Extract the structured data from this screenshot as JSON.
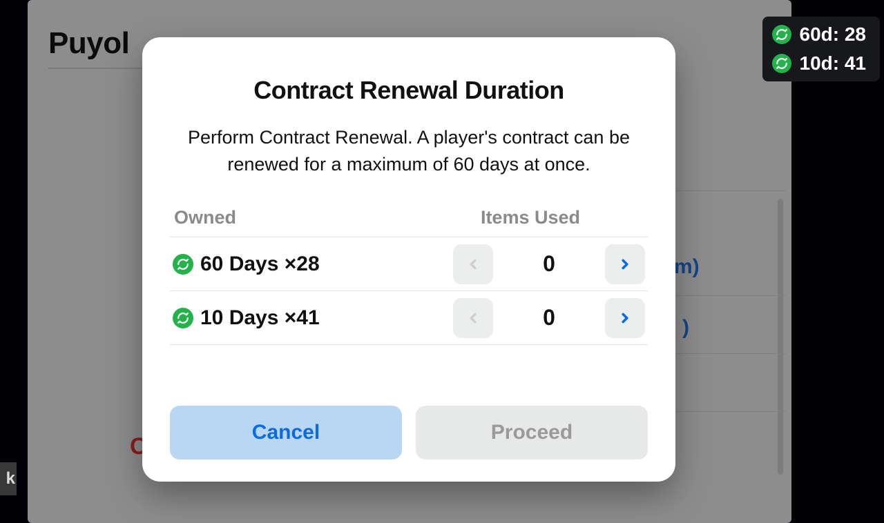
{
  "background": {
    "player_name": "Puyol",
    "peek_c": "C",
    "peek_m": "m)",
    "peek_paren": ")",
    "peek_k": "k"
  },
  "counter": {
    "items": [
      {
        "label": "60d: 28"
      },
      {
        "label": "10d: 41"
      }
    ]
  },
  "modal": {
    "title": "Contract Renewal Duration",
    "description": "Perform Contract Renewal. A player's contract can be renewed for a maximum of 60 days at once.",
    "table": {
      "owned_header": "Owned",
      "used_header": "Items Used",
      "rows": [
        {
          "label": "60 Days ×28",
          "value": "0"
        },
        {
          "label": "10 Days ×41",
          "value": "0"
        }
      ]
    },
    "buttons": {
      "cancel": "Cancel",
      "proceed": "Proceed"
    }
  }
}
